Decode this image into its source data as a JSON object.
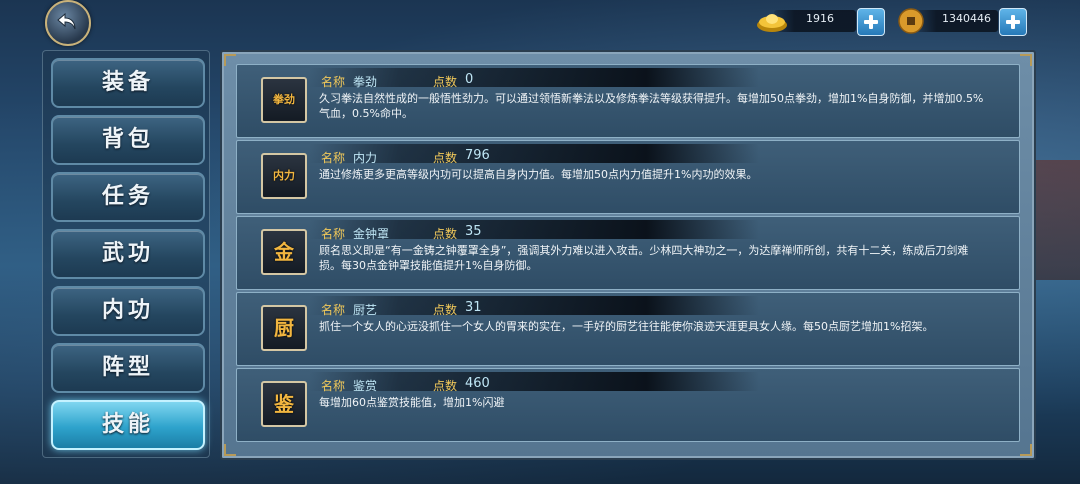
{
  "resources": {
    "gold": {
      "icon": "gold-ingot-icon",
      "value": "1916"
    },
    "coins": {
      "icon": "copper-coin-icon",
      "value": "1340446"
    }
  },
  "tabs": [
    {
      "label": "装备",
      "active": false
    },
    {
      "label": "背包",
      "active": false
    },
    {
      "label": "任务",
      "active": false
    },
    {
      "label": "武功",
      "active": false
    },
    {
      "label": "内功",
      "active": false
    },
    {
      "label": "阵型",
      "active": false
    },
    {
      "label": "技能",
      "active": true
    }
  ],
  "skills": [
    {
      "icon_text": "拳劲",
      "name_label": "名称",
      "name": "拳劲",
      "points_label": "点数",
      "points": "0",
      "desc": "久习拳法自然性成的一般悟性劲力。可以通过领悟新拳法以及修炼拳法等级获得提升。每增加50点拳劲，增加1%自身防御，并增加0.5%气血，0.5%命中。"
    },
    {
      "icon_text": "内力",
      "name_label": "名称",
      "name": "内力",
      "points_label": "点数",
      "points": "796",
      "desc": "通过修炼更多更高等级内功可以提高自身内力值。每增加50点内力值提升1%内功的效果。"
    },
    {
      "icon_text": "金",
      "name_label": "名称",
      "name": "金钟罩",
      "points_label": "点数",
      "points": "35",
      "desc": "顾名思义即是“有一金铸之钟覆罩全身”，强调其外力难以进入攻击。少林四大神功之一，为达摩禅师所创，共有十二关，练成后刀剑难损。每30点金钟罩技能值提升1%自身防御。"
    },
    {
      "icon_text": "厨",
      "name_label": "名称",
      "name": "厨艺",
      "points_label": "点数",
      "points": "31",
      "desc": "抓住一个女人的心远没抓住一个女人的胃来的实在，一手好的厨艺往往能使你浪迹天涯更具女人缘。每50点厨艺增加1%招架。"
    },
    {
      "icon_text": "鉴",
      "name_label": "名称",
      "name": "鉴赏",
      "points_label": "点数",
      "points": "460",
      "desc": "每增加60点鉴赏技能值，增加1%闪避"
    }
  ]
}
